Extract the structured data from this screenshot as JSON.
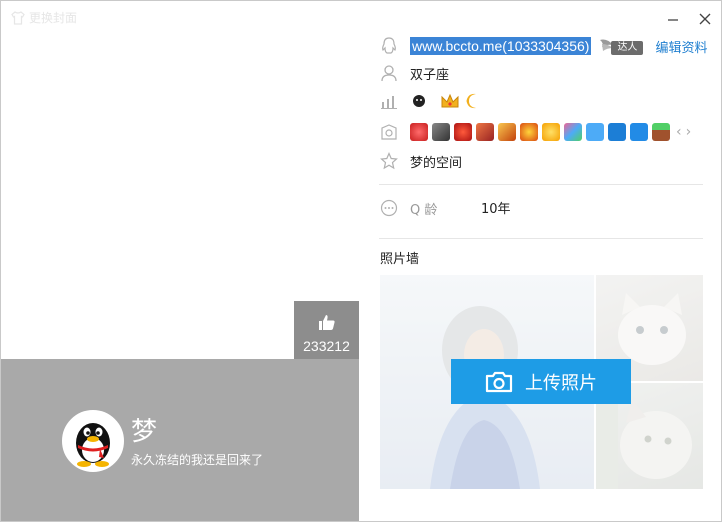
{
  "window": {
    "change_cover_label": "更换封面"
  },
  "profile": {
    "nickname": "梦",
    "signature": "永久冻结的我还是回来了",
    "likes": "233212"
  },
  "info": {
    "url_id": "www.bccto.me(1033304356)",
    "vip_tag": "达人",
    "edit_label": "编辑资料",
    "zodiac": "双子座",
    "space": "梦的空间",
    "qage_label": "Q 龄",
    "qage_value": "10年"
  },
  "photo_wall": {
    "title": "照片墙",
    "upload_label": "上传照片"
  },
  "colors": {
    "accent_blue": "#1e9ce6",
    "link_blue": "#1f7fd0",
    "selection_blue": "#3b84d6",
    "panel_gray": "#a9a9a9",
    "like_box": "#8d8d8d"
  },
  "icons": {
    "qq": "qq-icon",
    "user": "user-icon",
    "level": "level-icon",
    "badge": "badge-icon",
    "star": "star-icon",
    "more": "more-icon",
    "thumb": "thumb-up-icon",
    "camera": "camera-icon"
  }
}
